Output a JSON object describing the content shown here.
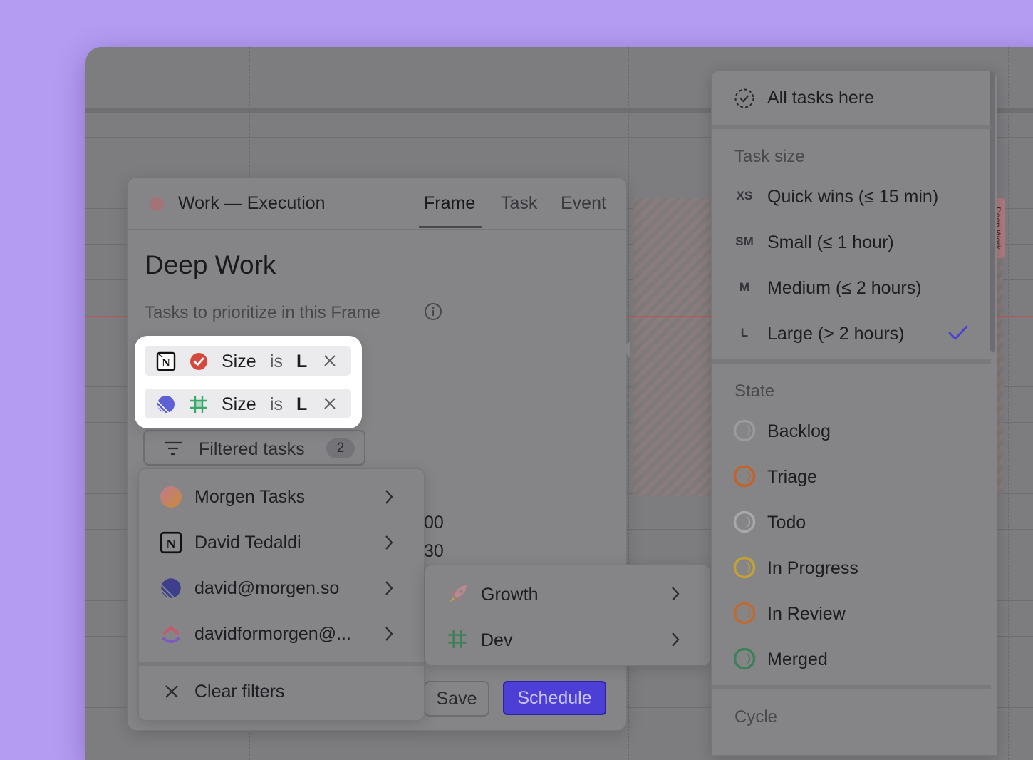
{
  "frame": {
    "calendar_name": "Work — Execution",
    "tabs": [
      "Frame",
      "Task",
      "Event"
    ],
    "active_tab": "Frame",
    "title": "Deep Work",
    "subtitle": "Tasks to prioritize in this Frame",
    "filter_chips": [
      {
        "source_icon": "notion-icon",
        "project_icon": "check-circle-icon",
        "field": "Size",
        "operator": "is",
        "value": "L"
      },
      {
        "source_icon": "linear-icon",
        "project_icon": "hash-grid-icon",
        "field": "Size",
        "operator": "is",
        "value": "L"
      }
    ],
    "filtered_tasks_label": "Filtered tasks",
    "filtered_tasks_count": "2",
    "time_start_partial": "00",
    "time_end_partial": "30",
    "save_label": "Save",
    "schedule_label": "Schedule"
  },
  "sources_menu": {
    "items": [
      {
        "label": "Morgen Tasks",
        "icon": "morgen-icon"
      },
      {
        "label": "David Tedaldi",
        "icon": "notion-icon"
      },
      {
        "label": "david@morgen.so",
        "icon": "linear-icon"
      },
      {
        "label": "davidformorgen@...",
        "icon": "clickup-icon"
      }
    ],
    "clear_label": "Clear filters"
  },
  "submenu": {
    "items": [
      {
        "label": "Growth",
        "icon": "rocket-icon"
      },
      {
        "label": "Dev",
        "icon": "hash-grid-icon"
      }
    ]
  },
  "filter_dropdown": {
    "all_tasks_label": "All tasks here",
    "task_size_heading": "Task size",
    "task_sizes": [
      {
        "code": "XS",
        "label": "Quick wins (≤ 15 min)",
        "selected": false
      },
      {
        "code": "SM",
        "label": "Small (≤ 1 hour)",
        "selected": false
      },
      {
        "code": "M",
        "label": "Medium (≤ 2 hours)",
        "selected": false
      },
      {
        "code": "L",
        "label": "Large (> 2 hours)",
        "selected": true
      }
    ],
    "state_heading": "State",
    "states": [
      {
        "label": "Backlog",
        "color": "#9a9a9e"
      },
      {
        "label": "Triage",
        "color": "#c4622a"
      },
      {
        "label": "Todo",
        "color": "#a8a8ac"
      },
      {
        "label": "In Progress",
        "color": "#c4a232"
      },
      {
        "label": "In Review",
        "color": "#c06a30"
      },
      {
        "label": "Merged",
        "color": "#3f7f5a"
      }
    ],
    "cycle_heading": "Cycle"
  },
  "calendar": {
    "event_label": "Deep Work"
  },
  "colors": {
    "background": "#b39cf2",
    "accent": "#4d3fd6",
    "check": "#4d3fd6",
    "now_line": "#b55a5a"
  }
}
